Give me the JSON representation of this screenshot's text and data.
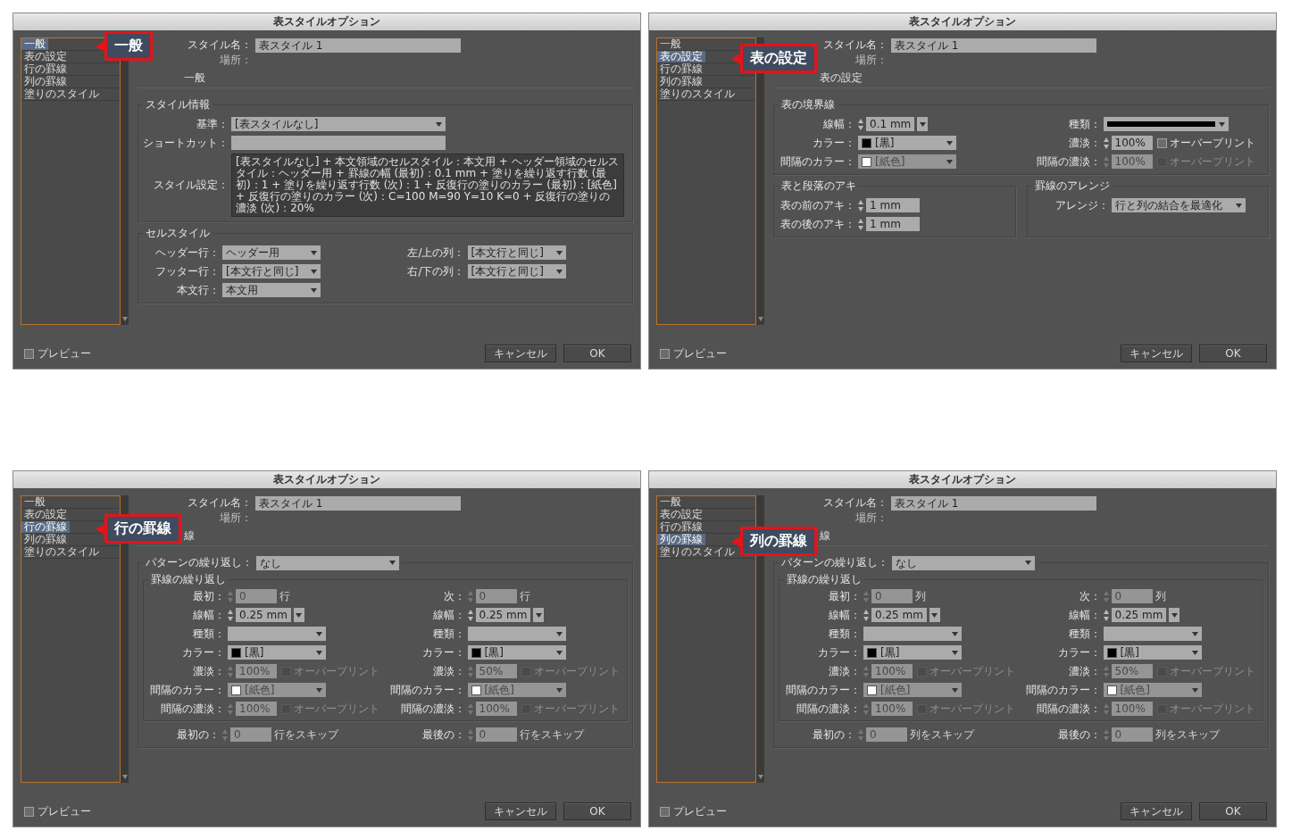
{
  "dialogs": [
    {
      "title": "表スタイルオプション",
      "callout": "一般",
      "sidebar": [
        {
          "label": "一般",
          "selected": true
        },
        {
          "label": "表の設定",
          "selected": false
        },
        {
          "label": "行の罫線",
          "selected": false
        },
        {
          "label": "列の罫線",
          "selected": false
        },
        {
          "label": "塗りのスタイル",
          "selected": false
        }
      ],
      "style_name": {
        "label": "スタイル名：",
        "value": "表スタイル 1"
      },
      "location_label": "場所：",
      "section_heading": "一般",
      "group_rows": [
        [
          {
            "title": "スタイル情報",
            "sections": [
              {
                "columns": [
                  [
                    {
                      "kind": "dropdown",
                      "label": "基準：",
                      "value": "[表スタイルなし]",
                      "disabled": false
                    },
                    {
                      "kind": "text",
                      "label": "ショートカット：",
                      "disabled": false
                    },
                    {
                      "kind": "textarea",
                      "label": "スタイル設定：",
                      "value": "[表スタイルなし] + 本文領域のセルスタイル：本文用 + ヘッダー領域のセルスタイル：ヘッダー用 + 罫線の幅 (最初)：0.1 mm + 塗りを繰り返す行数 (最初)：1 + 塗りを繰り返す行数 (次)：1 + 反復行の塗りのカラー (最初)：[紙色] + 反復行の塗りのカラー (次)：C=100 M=90 Y=10 K=0 + 反復行の塗りの濃淡 (次)：20%",
                      "disabled": false
                    }
                  ]
                ]
              }
            ]
          }
        ],
        [
          {
            "title": "セルスタイル",
            "sections": [
              {
                "columns": [
                  [
                    {
                      "kind": "dropdown",
                      "label": "ヘッダー行：",
                      "value": "ヘッダー用",
                      "disabled": false
                    },
                    {
                      "kind": "dropdown",
                      "label": "フッター行：",
                      "value": "[本文行と同じ]",
                      "disabled": false
                    },
                    {
                      "kind": "dropdown",
                      "label": "本文行：",
                      "value": "本文用",
                      "disabled": false
                    }
                  ],
                  [
                    {
                      "kind": "dropdown",
                      "label": "左/上の列：",
                      "value": "[本文行と同じ]",
                      "disabled": false
                    },
                    {
                      "kind": "dropdown",
                      "label": "右/下の列：",
                      "value": "[本文行と同じ]",
                      "disabled": false
                    }
                  ]
                ]
              }
            ]
          }
        ]
      ],
      "preview": {
        "label": "プレビュー",
        "checked": false
      },
      "buttons": [
        "キャンセル",
        "OK"
      ]
    },
    {
      "title": "表スタイルオプション",
      "callout": "表の設定",
      "sidebar": [
        {
          "label": "一般",
          "selected": false
        },
        {
          "label": "表の設定",
          "selected": true
        },
        {
          "label": "行の罫線",
          "selected": false
        },
        {
          "label": "列の罫線",
          "selected": false
        },
        {
          "label": "塗りのスタイル",
          "selected": false
        }
      ],
      "style_name": {
        "label": "スタイル名：",
        "value": "表スタイル 1"
      },
      "location_label": "場所：",
      "section_heading": "表の設定",
      "group_rows": [
        [
          {
            "title": "表の境界線",
            "sections": [
              {
                "columns": [
                  [
                    {
                      "kind": "spinner_menu",
                      "label": "線幅：",
                      "value": "0.1 mm",
                      "disabled": false
                    },
                    {
                      "kind": "dropdown",
                      "label": "カラー：",
                      "value": "[黒]",
                      "color": "#000000",
                      "disabled": false
                    },
                    {
                      "kind": "dropdown",
                      "label": "間隔のカラー：",
                      "value": "[紙色]",
                      "color": "#ffffff",
                      "disabled": true
                    }
                  ],
                  [
                    {
                      "kind": "line",
                      "label": "種類：",
                      "disabled": false
                    },
                    {
                      "kind": "spinner",
                      "label": "濃淡：",
                      "value": "100%",
                      "disabled": false,
                      "overprint": {
                        "label": "オーバープリント",
                        "checked": false,
                        "disabled": false
                      }
                    },
                    {
                      "kind": "spinner",
                      "label": "間隔の濃淡：",
                      "value": "100%",
                      "disabled": true,
                      "overprint": {
                        "label": "オーバープリント",
                        "checked": false,
                        "disabled": true
                      }
                    }
                  ]
                ]
              }
            ]
          }
        ],
        [
          {
            "title": "表と段落のアキ",
            "sections": [
              {
                "columns": [
                  [
                    {
                      "kind": "spinner",
                      "label": "表の前のアキ：",
                      "value": "1 mm",
                      "disabled": false
                    },
                    {
                      "kind": "spinner",
                      "label": "表の後のアキ：",
                      "value": "1 mm",
                      "disabled": false
                    }
                  ]
                ]
              }
            ]
          },
          {
            "title": "罫線のアレンジ",
            "sections": [
              {
                "columns": [
                  [
                    {
                      "kind": "dropdown",
                      "label": "アレンジ：",
                      "value": "行と列の結合を最適化",
                      "disabled": false
                    }
                  ]
                ]
              }
            ]
          }
        ]
      ],
      "preview": {
        "label": "プレビュー",
        "checked": false
      },
      "buttons": [
        "キャンセル",
        "OK"
      ]
    },
    {
      "title": "表スタイルオプション",
      "callout": "行の罫線",
      "sidebar": [
        {
          "label": "一般",
          "selected": false
        },
        {
          "label": "表の設定",
          "selected": false
        },
        {
          "label": "行の罫線",
          "selected": true
        },
        {
          "label": "列の罫線",
          "selected": false
        },
        {
          "label": "塗りのスタイル",
          "selected": false
        }
      ],
      "style_name": {
        "label": "スタイル名：",
        "value": "表スタイル 1"
      },
      "location_label": "場所：",
      "section_heading": "線",
      "group_rows": [
        [
          {
            "legend": {
              "kind": "dropdown",
              "label": "パターンの繰り返し：",
              "value": "なし",
              "disabled": false
            },
            "sections": [
              {
                "title": "罫線の繰り返し",
                "columns": [
                  [
                    {
                      "kind": "spinner",
                      "label": "最初：",
                      "value": "0",
                      "suffix": "行",
                      "disabled": true
                    },
                    {
                      "kind": "spinner_menu",
                      "label": "線幅：",
                      "value": "0.25 mm",
                      "disabled": false
                    },
                    {
                      "kind": "dropdown",
                      "label": "種類：",
                      "disabled": false
                    },
                    {
                      "kind": "dropdown",
                      "label": "カラー：",
                      "value": "[黒]",
                      "color": "#000000",
                      "disabled": false
                    },
                    {
                      "kind": "spinner",
                      "label": "濃淡：",
                      "value": "100%",
                      "disabled": true,
                      "overprint": {
                        "label": "オーバープリント",
                        "checked": false,
                        "disabled": true
                      }
                    },
                    {
                      "kind": "dropdown",
                      "label": "間隔のカラー：",
                      "value": "[紙色]",
                      "color": "#ffffff",
                      "disabled": true
                    },
                    {
                      "kind": "spinner",
                      "label": "間隔の濃淡：",
                      "value": "100%",
                      "disabled": true,
                      "overprint": {
                        "label": "オーバープリント",
                        "checked": false,
                        "disabled": true
                      }
                    }
                  ],
                  [
                    {
                      "kind": "spinner",
                      "label": "次：",
                      "value": "0",
                      "suffix": "行",
                      "disabled": true
                    },
                    {
                      "kind": "spinner_menu",
                      "label": "線幅：",
                      "value": "0.25 mm",
                      "disabled": false
                    },
                    {
                      "kind": "dropdown",
                      "label": "種類：",
                      "disabled": false
                    },
                    {
                      "kind": "dropdown",
                      "label": "カラー：",
                      "value": "[黒]",
                      "color": "#000000",
                      "disabled": false
                    },
                    {
                      "kind": "spinner",
                      "label": "濃淡：",
                      "value": "50%",
                      "disabled": true,
                      "overprint": {
                        "label": "オーバープリント",
                        "checked": false,
                        "disabled": true
                      }
                    },
                    {
                      "kind": "dropdown",
                      "label": "間隔のカラー：",
                      "value": "[紙色]",
                      "color": "#ffffff",
                      "disabled": true
                    },
                    {
                      "kind": "spinner",
                      "label": "間隔の濃淡：",
                      "value": "100%",
                      "disabled": true,
                      "overprint": {
                        "label": "オーバープリント",
                        "checked": false,
                        "disabled": true
                      }
                    }
                  ]
                ]
              },
              {
                "columns": [
                  [
                    {
                      "kind": "spinner",
                      "label": "最初の：",
                      "value": "0",
                      "suffix": "行をスキップ",
                      "disabled": true
                    }
                  ],
                  [
                    {
                      "kind": "spinner",
                      "label": "最後の：",
                      "value": "0",
                      "suffix": "行をスキップ",
                      "disabled": true
                    }
                  ]
                ]
              }
            ]
          }
        ]
      ],
      "preview": {
        "label": "プレビュー",
        "checked": false
      },
      "buttons": [
        "キャンセル",
        "OK"
      ]
    },
    {
      "title": "表スタイルオプション",
      "callout": "列の罫線",
      "sidebar": [
        {
          "label": "一般",
          "selected": false
        },
        {
          "label": "表の設定",
          "selected": false
        },
        {
          "label": "行の罫線",
          "selected": false
        },
        {
          "label": "列の罫線",
          "selected": true
        },
        {
          "label": "塗りのスタイル",
          "selected": false
        }
      ],
      "style_name": {
        "label": "スタイル名：",
        "value": "表スタイル 1"
      },
      "location_label": "場所：",
      "section_heading": "線",
      "group_rows": [
        [
          {
            "legend": {
              "kind": "dropdown",
              "label": "パターンの繰り返し：",
              "value": "なし",
              "disabled": false
            },
            "sections": [
              {
                "title": "罫線の繰り返し",
                "columns": [
                  [
                    {
                      "kind": "spinner",
                      "label": "最初：",
                      "value": "0",
                      "suffix": "列",
                      "disabled": true
                    },
                    {
                      "kind": "spinner_menu",
                      "label": "線幅：",
                      "value": "0.25 mm",
                      "disabled": false
                    },
                    {
                      "kind": "dropdown",
                      "label": "種類：",
                      "disabled": false
                    },
                    {
                      "kind": "dropdown",
                      "label": "カラー：",
                      "value": "[黒]",
                      "color": "#000000",
                      "disabled": false
                    },
                    {
                      "kind": "spinner",
                      "label": "濃淡：",
                      "value": "100%",
                      "disabled": true,
                      "overprint": {
                        "label": "オーバープリント",
                        "checked": false,
                        "disabled": true
                      }
                    },
                    {
                      "kind": "dropdown",
                      "label": "間隔のカラー：",
                      "value": "[紙色]",
                      "color": "#ffffff",
                      "disabled": true
                    },
                    {
                      "kind": "spinner",
                      "label": "間隔の濃淡：",
                      "value": "100%",
                      "disabled": true,
                      "overprint": {
                        "label": "オーバープリント",
                        "checked": false,
                        "disabled": true
                      }
                    }
                  ],
                  [
                    {
                      "kind": "spinner",
                      "label": "次：",
                      "value": "0",
                      "suffix": "列",
                      "disabled": true
                    },
                    {
                      "kind": "spinner_menu",
                      "label": "線幅：",
                      "value": "0.25 mm",
                      "disabled": false
                    },
                    {
                      "kind": "dropdown",
                      "label": "種類：",
                      "disabled": false
                    },
                    {
                      "kind": "dropdown",
                      "label": "カラー：",
                      "value": "[黒]",
                      "color": "#000000",
                      "disabled": false
                    },
                    {
                      "kind": "spinner",
                      "label": "濃淡：",
                      "value": "50%",
                      "disabled": true,
                      "overprint": {
                        "label": "オーバープリント",
                        "checked": false,
                        "disabled": true
                      }
                    },
                    {
                      "kind": "dropdown",
                      "label": "間隔のカラー：",
                      "value": "[紙色]",
                      "color": "#ffffff",
                      "disabled": true
                    },
                    {
                      "kind": "spinner",
                      "label": "間隔の濃淡：",
                      "value": "100%",
                      "disabled": true,
                      "overprint": {
                        "label": "オーバープリント",
                        "checked": false,
                        "disabled": true
                      }
                    }
                  ]
                ]
              },
              {
                "columns": [
                  [
                    {
                      "kind": "spinner",
                      "label": "最初の：",
                      "value": "0",
                      "suffix": "列をスキップ",
                      "disabled": true
                    }
                  ],
                  [
                    {
                      "kind": "spinner",
                      "label": "最後の：",
                      "value": "0",
                      "suffix": "列をスキップ",
                      "disabled": true
                    }
                  ]
                ]
              }
            ]
          }
        ]
      ],
      "preview": {
        "label": "プレビュー",
        "checked": false
      },
      "buttons": [
        "キャンセル",
        "OK"
      ]
    }
  ]
}
